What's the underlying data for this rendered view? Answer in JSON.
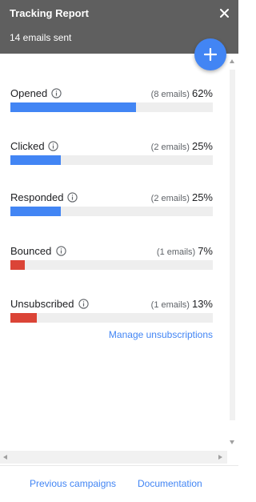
{
  "header": {
    "title": "Tracking Report",
    "subtitle": "14 emails sent",
    "close_icon": "close-icon",
    "add_icon": "plus-icon"
  },
  "colors": {
    "header_bg": "#5f5f5f",
    "accent": "#4285f4",
    "bar_blue": "#4285f4",
    "bar_red": "#db4437",
    "bar_track": "#eeeeee"
  },
  "metrics": [
    {
      "label": "Opened",
      "count": "(8 emails)",
      "percent": "62%",
      "value": 62,
      "color": "#4285f4",
      "icon": "info-icon"
    },
    {
      "label": "Clicked",
      "count": "(2 emails)",
      "percent": "25%",
      "value": 25,
      "color": "#4285f4",
      "icon": "info-icon"
    },
    {
      "label": "Responded",
      "count": "(2 emails)",
      "percent": "25%",
      "value": 25,
      "color": "#4285f4",
      "icon": "info-icon"
    },
    {
      "label": "Bounced",
      "count": "(1 emails)",
      "percent": "7%",
      "value": 7,
      "color": "#db4437",
      "icon": "info-icon"
    },
    {
      "label": "Unsubscribed",
      "count": "(1 emails)",
      "percent": "13%",
      "value": 13,
      "color": "#db4437",
      "icon": "info-icon"
    }
  ],
  "manage_link": "Manage unsubscriptions",
  "footer": {
    "previous": "Previous campaigns",
    "documentation": "Documentation"
  }
}
